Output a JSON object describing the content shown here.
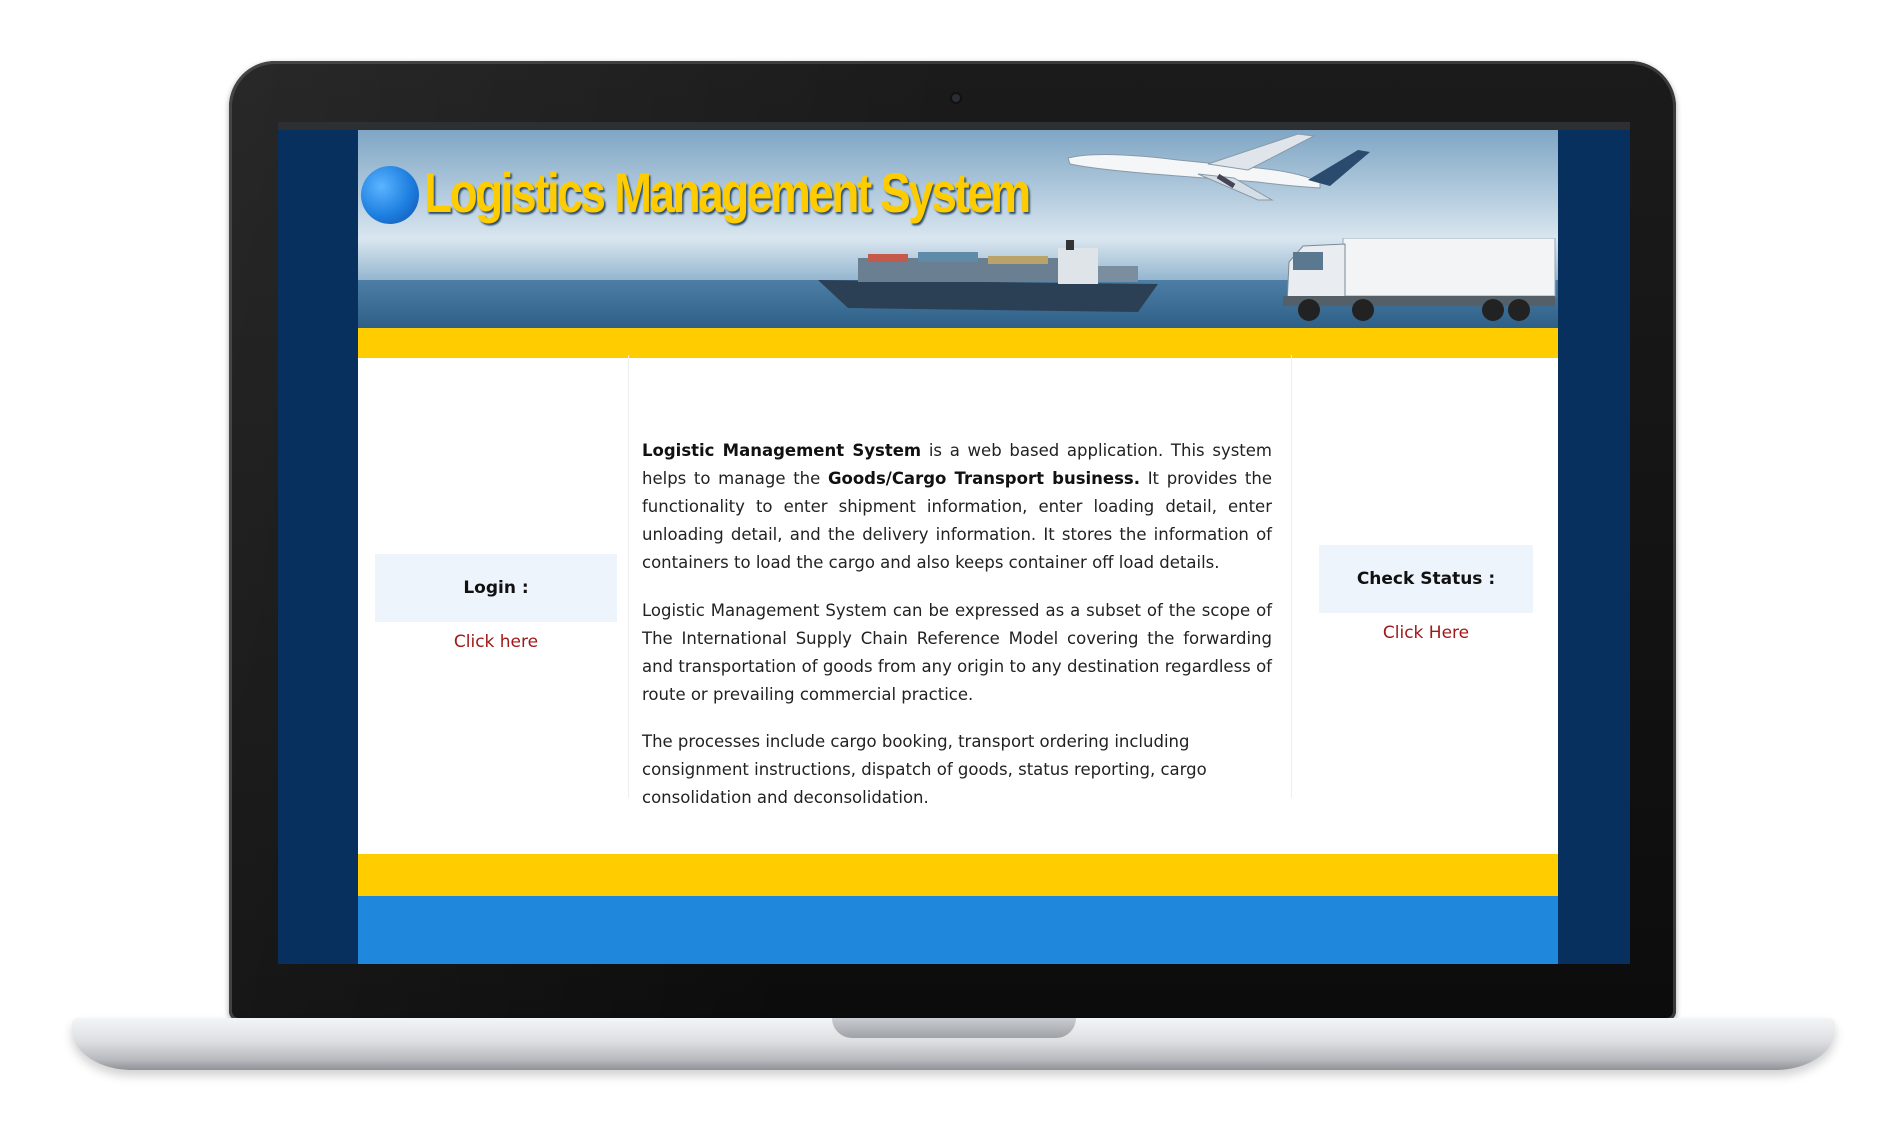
{
  "banner": {
    "title": "Logistics Management System"
  },
  "login": {
    "label": "Login :",
    "link": "Click here"
  },
  "check_status": {
    "label": "Check Status :",
    "link": "Click Here"
  },
  "content": {
    "p1_bold1": "Logistic Management System",
    "p1_text1": " is a web based application. This system helps to manage the ",
    "p1_bold2": "Goods/Cargo Transport business.",
    "p1_text2": " It provides the functionality to enter shipment information, enter loading detail, enter unloading detail, and the delivery information. It stores the information of containers to load the cargo and also keeps container off load details.",
    "p2": "Logistic Management System can be expressed as a subset of the scope of The International Supply Chain Reference Model covering the forwarding and transportation of goods from any origin to any destination regardless of route or prevailing commercial practice.",
    "p3": "The processes include cargo booking, transport ordering including consignment instructions, dispatch of goods, status reporting, cargo consolidation and deconsolidation."
  },
  "colors": {
    "screen_bg": "#07305e",
    "title": "#ffcc00",
    "yellow_bar": "#ffcc00",
    "footer": "#2088dc",
    "link": "#a01818",
    "side_box": "#eef4fb"
  }
}
